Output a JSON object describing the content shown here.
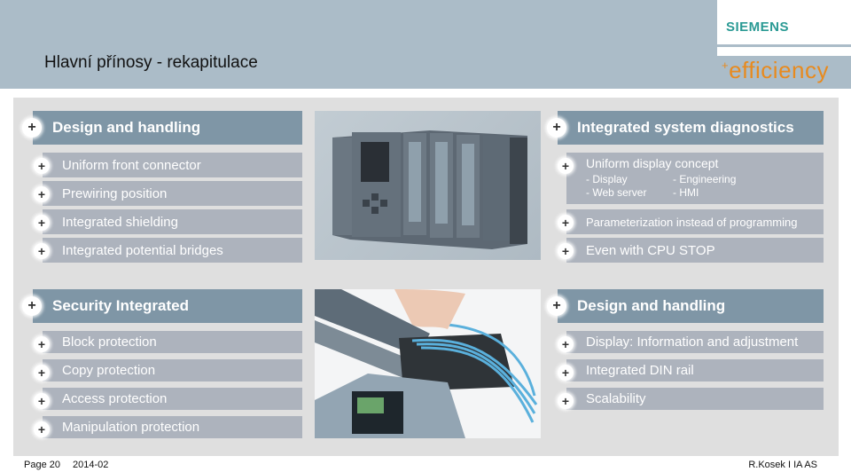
{
  "header": {
    "title": "Hlavní přínosy - rekapitulace",
    "brand": "SIEMENS",
    "tagline_prefix": "+",
    "tagline": "efficiency",
    "brand_color": "#2a9a94",
    "tagline_color": "#e88a1e"
  },
  "panels": [
    {
      "title": "Design and handling",
      "items": [
        "Uniform front connector",
        "Prewiring position",
        "Integrated shielding",
        "Integrated potential bridges"
      ]
    },
    {
      "title": "Integrated system diagnostics",
      "items": [
        {
          "label": "Uniform display concept",
          "sub": [
            "- Display",
            "- Engineering",
            "- Web server",
            "- HMI"
          ]
        },
        {
          "label": "Parameterization instead of programming"
        },
        {
          "label": "Even with CPU STOP"
        }
      ]
    },
    {
      "title": "Security Integrated",
      "items": [
        "Block protection",
        "Copy protection",
        "Access protection",
        "Manipulation protection"
      ]
    },
    {
      "title": "Design and handling",
      "items": [
        "Display: Information and adjustment",
        "Integrated DIN rail",
        "Scalability"
      ]
    }
  ],
  "images": {
    "top": "plc-controller-photo",
    "bottom": "front-connector-wiring-photo"
  },
  "footer": {
    "page": "Page 20",
    "date": "2014-02",
    "author": "R.Kosek I IA AS"
  }
}
